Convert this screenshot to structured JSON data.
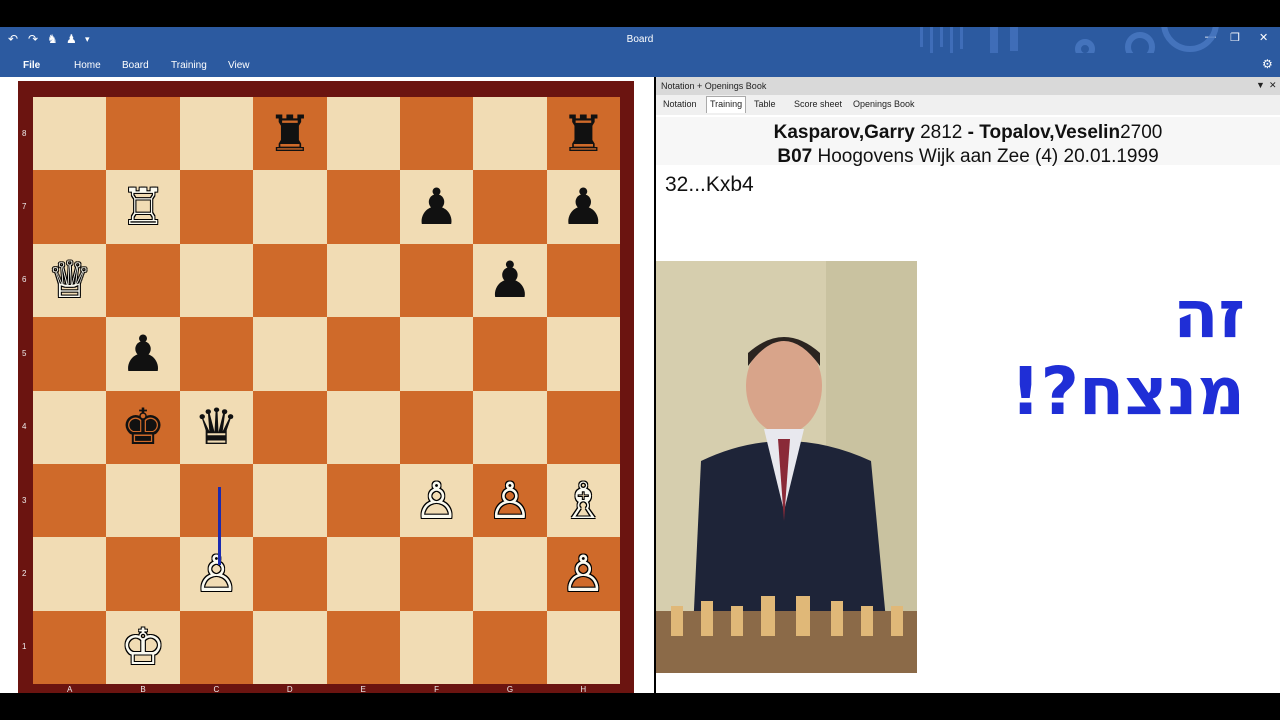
{
  "window": {
    "title": "Board"
  },
  "menu": {
    "file": "File",
    "home": "Home",
    "board": "Board",
    "training": "Training",
    "view": "View"
  },
  "panel": {
    "title": "Notation + Openings Book",
    "tabs": [
      "Notation",
      "Training",
      "Table",
      "Score sheet",
      "Openings Book"
    ],
    "active_tab": "Training"
  },
  "game": {
    "white": "Kasparov,Garry",
    "white_elo": "2812",
    "separator": "-",
    "black": "Topalov,Veselin",
    "black_elo": "2700",
    "eco": "B07",
    "event": "Hoogovens Wijk aan Zee (4) 20.01.1999",
    "current_move": "32...Kxb4"
  },
  "overlay_text": "זה מנצח?!",
  "board": {
    "files": [
      "A",
      "B",
      "C",
      "D",
      "E",
      "F",
      "G",
      "H"
    ],
    "ranks": [
      "8",
      "7",
      "6",
      "5",
      "4",
      "3",
      "2",
      "1"
    ],
    "pieces": [
      {
        "sq": "d8",
        "piece": "rook",
        "color": "black",
        "glyph": "♜"
      },
      {
        "sq": "h8",
        "piece": "rook",
        "color": "black",
        "glyph": "♜"
      },
      {
        "sq": "b7",
        "piece": "rook",
        "color": "white",
        "glyph": "♖"
      },
      {
        "sq": "f7",
        "piece": "pawn",
        "color": "black",
        "glyph": "♟"
      },
      {
        "sq": "h7",
        "piece": "pawn",
        "color": "black",
        "glyph": "♟"
      },
      {
        "sq": "a6",
        "piece": "queen",
        "color": "white",
        "glyph": "♕"
      },
      {
        "sq": "g6",
        "piece": "pawn",
        "color": "black",
        "glyph": "♟"
      },
      {
        "sq": "b5",
        "piece": "pawn",
        "color": "black",
        "glyph": "♟"
      },
      {
        "sq": "b4",
        "piece": "king",
        "color": "black",
        "glyph": "♚"
      },
      {
        "sq": "c4",
        "piece": "queen",
        "color": "black",
        "glyph": "♛"
      },
      {
        "sq": "f3",
        "piece": "pawn",
        "color": "white",
        "glyph": "♙"
      },
      {
        "sq": "g3",
        "piece": "pawn",
        "color": "white",
        "glyph": "♙"
      },
      {
        "sq": "h3",
        "piece": "bishop",
        "color": "white",
        "glyph": "♗"
      },
      {
        "sq": "c2",
        "piece": "pawn",
        "color": "white",
        "glyph": "♙"
      },
      {
        "sq": "h2",
        "piece": "pawn",
        "color": "white",
        "glyph": "♙"
      },
      {
        "sq": "b1",
        "piece": "king",
        "color": "white",
        "glyph": "♔"
      }
    ],
    "arrow": {
      "from": "c2",
      "to": "c3",
      "color": "#1a2ab0"
    }
  },
  "colors": {
    "accent": "#2c5aa0",
    "light_square": "#f1dcb4",
    "dark_square": "#cf6a2a",
    "frame": "#6b1410",
    "overlay_text": "#1f2ed6"
  }
}
